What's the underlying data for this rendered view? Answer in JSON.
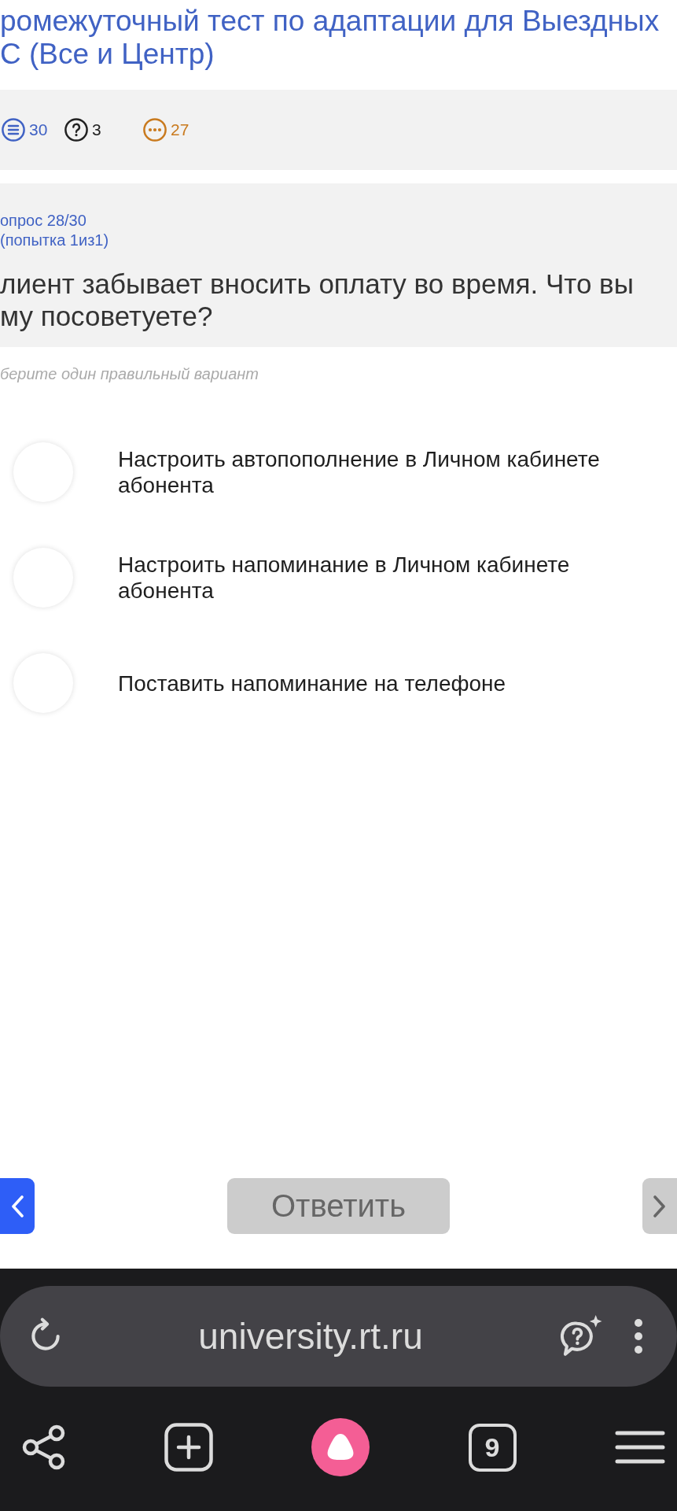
{
  "header": {
    "title": "ромежуточный тест по адаптации для Выездных С (Все и Центр)"
  },
  "stats": [
    {
      "kind": "total",
      "count": "30"
    },
    {
      "kind": "question",
      "count": "3"
    },
    {
      "kind": "pending",
      "count": "27"
    }
  ],
  "question": {
    "number": "опрос 28/30",
    "attempt": "(попытка 1из1)",
    "text": "лиент забывает вносить оплату во время. Что вы му посоветуете?",
    "hint": "берите один правильный вариант"
  },
  "options": [
    {
      "label": "Настроить автопополнение в Личном кабинете абонента",
      "selected": false
    },
    {
      "label": "Настроить напоминание в Личном кабинете абонента",
      "selected": false
    },
    {
      "label": "Поставить напоминание на телефоне",
      "selected": false
    }
  ],
  "navigation": {
    "previous": {
      "disabled": false
    },
    "submit": {
      "label": "Ответить",
      "disabled": true
    },
    "next": {
      "disabled": true
    }
  },
  "browser": {
    "url": "university.rt.ru",
    "tab_count": "9"
  }
}
